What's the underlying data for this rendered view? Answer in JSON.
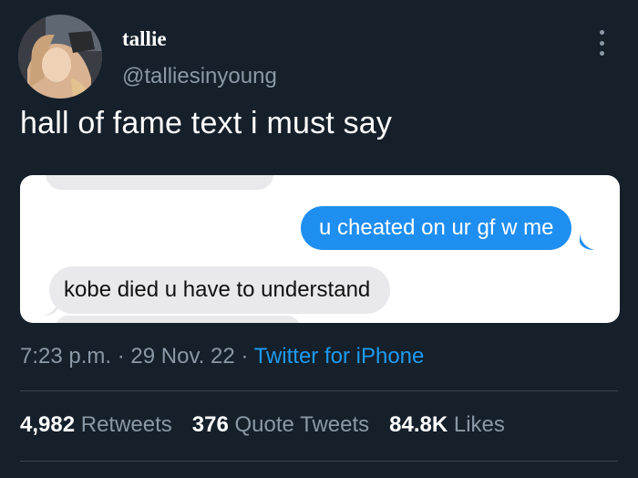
{
  "author": {
    "display_name": "tallie",
    "handle": "@talliesinyoung"
  },
  "tweet": {
    "text": "hall of fame text i must say",
    "time": "7:23 p.m.",
    "date": "29 Nov. 22",
    "separator": "·",
    "source": "Twitter for iPhone"
  },
  "screenshot": {
    "partial_top_message": "...",
    "sent_message": "u cheated on ur gf w me",
    "received_message": "kobe died u have to understand"
  },
  "stats": {
    "retweets_count": "4,982",
    "retweets_label": "Retweets",
    "quote_count": "376",
    "quote_label": "Quote Tweets",
    "likes_count": "84.8K",
    "likes_label": "Likes"
  },
  "colors": {
    "background": "#15202b",
    "accent": "#1d9bf0",
    "imessage_blue": "#1f8ef1",
    "secondary_text": "#8b98a5"
  },
  "icons": {
    "more": "more-vertical-icon"
  }
}
